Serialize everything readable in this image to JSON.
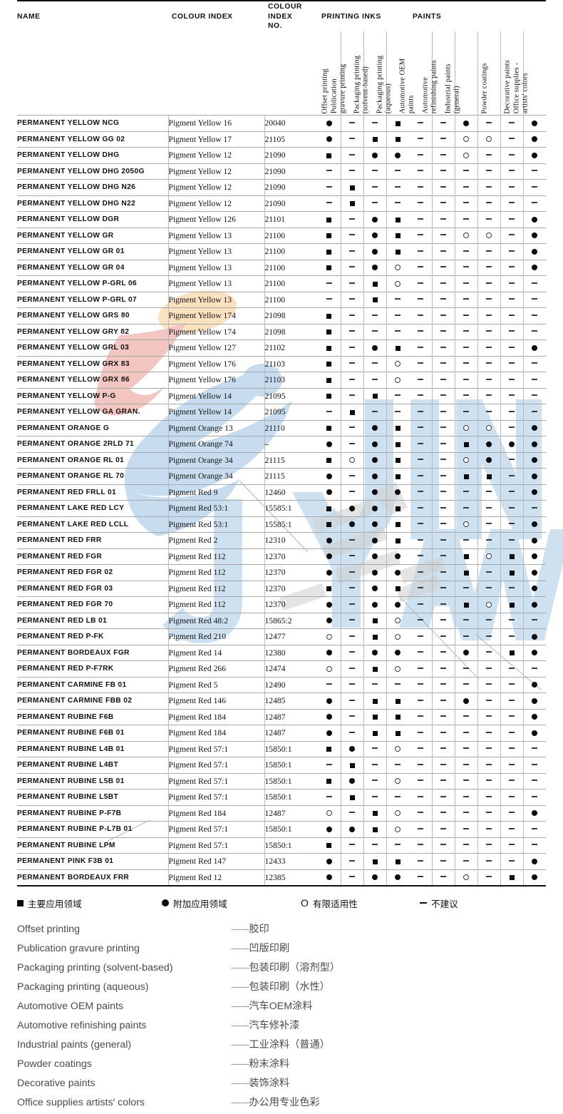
{
  "table": {
    "headers": {
      "name": "NAME",
      "colour_index": "COLOUR INDEX",
      "colour_index_no": "COLOUR\nINDEX\nNO.",
      "colour_index_no_l1": "COLOUR",
      "colour_index_no_l2": "INDEX",
      "colour_index_no_l3": "NO.",
      "group_printing_inks": "PRINTING INKS",
      "group_paints": "PAINTS"
    },
    "columns": [
      {
        "id": "offset",
        "group": "PRINTING INKS",
        "lines": [
          "Offset printing"
        ]
      },
      {
        "id": "pub_gravure",
        "group": "PRINTING INKS",
        "lines": [
          "Publication",
          "gravure printing"
        ]
      },
      {
        "id": "pack_solvent",
        "group": "PRINTING INKS",
        "lines": [
          "Packaging printing",
          "(solvent-based)"
        ]
      },
      {
        "id": "pack_aqueous",
        "group": "PRINTING INKS",
        "lines": [
          "Packaging printing",
          "(aqueous)"
        ]
      },
      {
        "id": "auto_oem",
        "group": "PAINTS",
        "lines": [
          "Automotive OEM",
          "paints"
        ]
      },
      {
        "id": "auto_refinish",
        "group": "PAINTS",
        "lines": [
          "Automotive",
          "refinishing paints"
        ]
      },
      {
        "id": "industrial",
        "group": "PAINTS",
        "lines": [
          "Industrial paints",
          "(general)"
        ]
      },
      {
        "id": "powder",
        "group": "PAINTS",
        "lines": [
          "Powder coatings"
        ]
      },
      {
        "id": "decorative",
        "group": "PAINTS",
        "lines": [
          "Decorative paints"
        ]
      },
      {
        "id": "office",
        "group": "PAINTS",
        "lines": [
          "Office supplies -",
          "artists' colors"
        ]
      }
    ],
    "rows": [
      {
        "name": "PERMANENT YELLOW NCG",
        "ci": "Pigment Yellow 16",
        "cino": "20040",
        "s": [
          "ci",
          "da",
          "da",
          "sq",
          "da",
          "da",
          "ci",
          "da",
          "da",
          "ci"
        ]
      },
      {
        "name": "PERMANENT YELLOW GG 02",
        "ci": "Pigment Yellow 17",
        "cino": "21105",
        "s": [
          "ci",
          "da",
          "sq",
          "sq",
          "da",
          "da",
          "oc",
          "oc",
          "da",
          "ci"
        ]
      },
      {
        "name": "PERMANENT YELLOW DHG",
        "ci": "Pigment Yellow 12",
        "cino": "21090",
        "s": [
          "sq",
          "da",
          "ci",
          "ci",
          "da",
          "da",
          "oc",
          "da",
          "da",
          "ci"
        ]
      },
      {
        "name": "PERMANENT YELLOW DHG 2050G",
        "ci": "Pigment Yellow 12",
        "cino": "21090",
        "s": [
          "da",
          "da",
          "da",
          "da",
          "da",
          "da",
          "da",
          "da",
          "da",
          "da"
        ]
      },
      {
        "name": "PERMANENT YELLOW DHG N26",
        "ci": "Pigment Yellow 12",
        "cino": "21090",
        "s": [
          "da",
          "sq",
          "da",
          "da",
          "da",
          "da",
          "da",
          "da",
          "da",
          "da"
        ]
      },
      {
        "name": "PERMANENT YELLOW DHG N22",
        "ci": "Pigment Yellow 12",
        "cino": "21090",
        "s": [
          "da",
          "sq",
          "da",
          "da",
          "da",
          "da",
          "da",
          "da",
          "da",
          "da"
        ]
      },
      {
        "name": "PERMANENT YELLOW DGR",
        "ci": "Pigment Yellow 126",
        "cino": "21101",
        "s": [
          "sq",
          "da",
          "ci",
          "sq",
          "da",
          "da",
          "da",
          "da",
          "da",
          "ci"
        ]
      },
      {
        "name": "PERMANENT YELLOW GR",
        "ci": "Pigment Yellow 13",
        "cino": "21100",
        "s": [
          "sq",
          "da",
          "ci",
          "sq",
          "da",
          "da",
          "oc",
          "oc",
          "da",
          "ci"
        ]
      },
      {
        "name": "PERMANENT YELLOW GR 01",
        "ci": "Pigment Yellow 13",
        "cino": "21100",
        "s": [
          "sq",
          "da",
          "ci",
          "sq",
          "da",
          "da",
          "da",
          "da",
          "da",
          "ci"
        ]
      },
      {
        "name": "PERMANENT YELLOW GR 04",
        "ci": "Pigment Yellow 13",
        "cino": "21100",
        "s": [
          "sq",
          "da",
          "ci",
          "oc",
          "da",
          "da",
          "da",
          "da",
          "da",
          "ci"
        ]
      },
      {
        "name": "PERMANENT YELLOW P-GRL 06",
        "ci": "Pigment Yellow 13",
        "cino": "21100",
        "s": [
          "da",
          "da",
          "sq",
          "oc",
          "da",
          "da",
          "da",
          "da",
          "da",
          "da"
        ]
      },
      {
        "name": "PERMANENT YELLOW P-GRL 07",
        "ci": "Pigment Yellow 13",
        "cino": "21100",
        "s": [
          "da",
          "da",
          "sq",
          "da",
          "da",
          "da",
          "da",
          "da",
          "da",
          "da"
        ]
      },
      {
        "name": "PERMANENT YELLOW GRS 80",
        "ci": "Pigment Yellow 174",
        "cino": "21098",
        "s": [
          "sq",
          "da",
          "da",
          "da",
          "da",
          "da",
          "da",
          "da",
          "da",
          "da"
        ]
      },
      {
        "name": "PERMANENT YELLOW GRY 82",
        "ci": "Pigment Yellow 174",
        "cino": "21098",
        "s": [
          "sq",
          "da",
          "da",
          "da",
          "da",
          "da",
          "da",
          "da",
          "da",
          "da"
        ]
      },
      {
        "name": "PERMANENT YELLOW GRL 03",
        "ci": "Pigment Yellow 127",
        "cino": "21102",
        "s": [
          "sq",
          "da",
          "ci",
          "sq",
          "da",
          "da",
          "da",
          "da",
          "da",
          "ci"
        ]
      },
      {
        "name": "PERMANENT YELLOW GRX 83",
        "ci": "Pigment Yellow 176",
        "cino": "21103",
        "s": [
          "sq",
          "da",
          "da",
          "oc",
          "da",
          "da",
          "da",
          "da",
          "da",
          "da"
        ]
      },
      {
        "name": "PERMANENT YELLOW GRX 86",
        "ci": "Pigment Yellow 176",
        "cino": "21103",
        "s": [
          "sq",
          "da",
          "da",
          "oc",
          "da",
          "da",
          "da",
          "da",
          "da",
          "da"
        ]
      },
      {
        "name": "PERMANENT YELLOW P-G",
        "ci": "Pigment Yellow 14",
        "cino": "21095",
        "s": [
          "sq",
          "da",
          "sq",
          "da",
          "da",
          "da",
          "da",
          "da",
          "da",
          "da"
        ]
      },
      {
        "name": "PERMANENT YELLOW GA GRAN.",
        "ci": "Pigment Yellow 14",
        "cino": "21095",
        "s": [
          "da",
          "sq",
          "da",
          "da",
          "da",
          "da",
          "da",
          "da",
          "da",
          "da"
        ]
      },
      {
        "name": "PERMANENT ORANGE G",
        "ci": "Pigment Orange 13",
        "cino": "21110",
        "s": [
          "sq",
          "da",
          "ci",
          "sq",
          "da",
          "da",
          "oc",
          "oc",
          "da",
          "ci"
        ]
      },
      {
        "name": "PERMANENT ORANGE 2RLD 71",
        "ci": "Pigment Orange 74",
        "cino": "–",
        "s": [
          "ci",
          "da",
          "ci",
          "sq",
          "da",
          "da",
          "sq",
          "ci",
          "ci",
          "ci"
        ]
      },
      {
        "name": "PERMANENT ORANGE RL 01",
        "ci": "Pigment Orange 34",
        "cino": "21115",
        "s": [
          "sq",
          "oc",
          "ci",
          "sq",
          "da",
          "da",
          "oc",
          "ci",
          "da",
          "ci"
        ]
      },
      {
        "name": "PERMANENT ORANGE RL 70",
        "ci": "Pigment Orange 34",
        "cino": "21115",
        "s": [
          "ci",
          "da",
          "ci",
          "sq",
          "da",
          "da",
          "sq",
          "sq",
          "da",
          "ci"
        ]
      },
      {
        "name": "PERMANENT RED FRLL 01",
        "ci": "Pigment Red 9",
        "cino": "12460",
        "s": [
          "ci",
          "da",
          "ci",
          "ci",
          "da",
          "da",
          "da",
          "da",
          "da",
          "ci"
        ]
      },
      {
        "name": "PERMANENT LAKE RED LCY",
        "ci": "Pigment Red 53:1",
        "cino": "15585:1",
        "s": [
          "sq",
          "ci",
          "ci",
          "sq",
          "da",
          "da",
          "da",
          "da",
          "da",
          "da"
        ]
      },
      {
        "name": "PERMANENT LAKE RED LCLL",
        "ci": "Pigment Red 53:1",
        "cino": "15585:1",
        "s": [
          "sq",
          "ci",
          "ci",
          "sq",
          "da",
          "da",
          "oc",
          "da",
          "da",
          "ci"
        ]
      },
      {
        "name": "PERMANENT RED FRR",
        "ci": "Pigment Red 2",
        "cino": "12310",
        "s": [
          "ci",
          "da",
          "ci",
          "sq",
          "da",
          "da",
          "da",
          "da",
          "da",
          "ci"
        ]
      },
      {
        "name": "PERMANENT RED FGR",
        "ci": "Pigment Red 112",
        "cino": "12370",
        "s": [
          "ci",
          "da",
          "ci",
          "ci",
          "da",
          "da",
          "sq",
          "oc",
          "sq",
          "ci"
        ]
      },
      {
        "name": "PERMANENT RED FGR 02",
        "ci": "Pigment Red 112",
        "cino": "12370",
        "s": [
          "ci",
          "da",
          "ci",
          "ci",
          "da",
          "da",
          "sq",
          "da",
          "sq",
          "ci"
        ]
      },
      {
        "name": "PERMANENT RED FGR 03",
        "ci": "Pigment Red 112",
        "cino": "12370",
        "s": [
          "sq",
          "da",
          "ci",
          "sq",
          "da",
          "da",
          "da",
          "da",
          "da",
          "ci"
        ]
      },
      {
        "name": "PERMANENT RED FGR 70",
        "ci": "Pigment Red 112",
        "cino": "12370",
        "s": [
          "ci",
          "da",
          "ci",
          "ci",
          "da",
          "da",
          "sq",
          "oc",
          "sq",
          "ci"
        ]
      },
      {
        "name": "PERMANENT RED LB 01",
        "ci": "Pigment Red 48:2",
        "cino": "15865:2",
        "s": [
          "ci",
          "da",
          "sq",
          "oc",
          "da",
          "da",
          "da",
          "da",
          "da",
          "da"
        ]
      },
      {
        "name": "PERMANENT RED P-FK",
        "ci": "Pigment Red 210",
        "cino": "12477",
        "s": [
          "oc",
          "da",
          "sq",
          "oc",
          "da",
          "da",
          "da",
          "da",
          "da",
          "ci"
        ]
      },
      {
        "name": "PERMANENT BORDEAUX FGR",
        "ci": "Pigment Red 14",
        "cino": "12380",
        "s": [
          "ci",
          "da",
          "ci",
          "ci",
          "da",
          "da",
          "ci",
          "da",
          "sq",
          "ci"
        ]
      },
      {
        "name": "PERMANENT RED P-F7RK",
        "ci": "Pigment Red 266",
        "cino": "12474",
        "s": [
          "oc",
          "da",
          "sq",
          "oc",
          "da",
          "da",
          "da",
          "da",
          "da",
          "da"
        ]
      },
      {
        "name": "PERMANENT CARMINE FB 01",
        "ci": "Pigment Red 5",
        "cino": "12490",
        "s": [
          "da",
          "da",
          "da",
          "da",
          "da",
          "da",
          "da",
          "da",
          "da",
          "ci"
        ]
      },
      {
        "name": "PERMANENT CARMINE FBB 02",
        "ci": "Pigment Red 146",
        "cino": "12485",
        "s": [
          "ci",
          "da",
          "sq",
          "sq",
          "da",
          "da",
          "ci",
          "da",
          "da",
          "ci"
        ]
      },
      {
        "name": "PERMANENT RUBINE F6B",
        "ci": "Pigment Red 184",
        "cino": "12487",
        "s": [
          "ci",
          "da",
          "sq",
          "sq",
          "da",
          "da",
          "da",
          "da",
          "da",
          "ci"
        ]
      },
      {
        "name": "PERMANENT RUBINE F6B 01",
        "ci": "Pigment Red 184",
        "cino": "12487",
        "s": [
          "ci",
          "da",
          "sq",
          "sq",
          "da",
          "da",
          "da",
          "da",
          "da",
          "ci"
        ]
      },
      {
        "name": "PERMANENT RUBINE L4B 01",
        "ci": "Pigment Red 57:1",
        "cino": "15850:1",
        "s": [
          "sq",
          "ci",
          "da",
          "oc",
          "da",
          "da",
          "da",
          "da",
          "da",
          "da"
        ]
      },
      {
        "name": "PERMANENT RUBINE L4BT",
        "ci": "Pigment Red 57:1",
        "cino": "15850:1",
        "s": [
          "da",
          "sq",
          "da",
          "da",
          "da",
          "da",
          "da",
          "da",
          "da",
          "da"
        ]
      },
      {
        "name": "PERMANENT RUBINE L5B 01",
        "ci": "Pigment Red 57:1",
        "cino": "15850:1",
        "s": [
          "sq",
          "ci",
          "da",
          "oc",
          "da",
          "da",
          "da",
          "da",
          "da",
          "da"
        ]
      },
      {
        "name": "PERMANENT RUBINE L5BT",
        "ci": "Pigment Red 57:1",
        "cino": "15850:1",
        "s": [
          "da",
          "sq",
          "da",
          "da",
          "da",
          "da",
          "da",
          "da",
          "da",
          "da"
        ]
      },
      {
        "name": "PERMANENT RUBINE P-F7B",
        "ci": "Pigment Red 184",
        "cino": "12487",
        "s": [
          "oc",
          "da",
          "sq",
          "oc",
          "da",
          "da",
          "da",
          "da",
          "da",
          "ci"
        ]
      },
      {
        "name": "PERMANENT RUBINE P-L7B 01",
        "ci": "Pigment Red 57:1",
        "cino": "15850:1",
        "s": [
          "ci",
          "ci",
          "sq",
          "oc",
          "da",
          "da",
          "da",
          "da",
          "da",
          "da"
        ]
      },
      {
        "name": "PERMANENT RUBINE LPM",
        "ci": "Pigment Red 57:1",
        "cino": "15850:1",
        "s": [
          "sq",
          "da",
          "da",
          "da",
          "da",
          "da",
          "da",
          "da",
          "da",
          "da"
        ]
      },
      {
        "name": "PERMANENT PINK F3B 01",
        "ci": "Pigment Red 147",
        "cino": "12433",
        "s": [
          "ci",
          "da",
          "sq",
          "sq",
          "da",
          "da",
          "da",
          "da",
          "da",
          "ci"
        ]
      },
      {
        "name": "PERMANENT BORDEAUX FRR",
        "ci": "Pigment Red 12",
        "cino": "12385",
        "s": [
          "ci",
          "da",
          "ci",
          "ci",
          "da",
          "da",
          "oc",
          "da",
          "sq",
          "ci"
        ]
      }
    ]
  },
  "legend_key": [
    {
      "glyph": "sq",
      "label": "主要应用领域"
    },
    {
      "glyph": "ci",
      "label": "附加应用领域"
    },
    {
      "glyph": "oc",
      "label": "有限适用性"
    },
    {
      "glyph": "da",
      "label": "不建议"
    }
  ],
  "glossary": [
    {
      "en": "Offset printing",
      "dots": "------",
      "zh": "胶印"
    },
    {
      "en": "Publication  gravure printing",
      "dots": "------",
      "zh": "凹版印刷"
    },
    {
      "en": "Packaging printing (solvent-based)",
      "dots": "------",
      "zh": "包装印刷（溶剂型）"
    },
    {
      "en": "Packaging printing (aqueous)",
      "dots": "------",
      "zh": "包装印刷（水性）"
    },
    {
      "en": "Automotive OEM paints",
      "dots": "------",
      "zh": "汽车OEM涂料"
    },
    {
      "en": "Automotive  refinishing paints",
      "dots": "------",
      "zh": "汽车修补漆"
    },
    {
      "en": "Industrial paints (general)",
      "dots": "------",
      "zh": "工业涂料（普通）"
    },
    {
      "en": "Powder coatings",
      "dots": "------",
      "zh": "粉末涂料"
    },
    {
      "en": "Decorative paints",
      "dots": "------",
      "zh": "装饰涂料"
    },
    {
      "en": "Office supplies artists′   colors",
      "dots": "------",
      "zh": "办公用专业色彩"
    }
  ],
  "colors": {
    "rule": "#111111",
    "hairline": "#a8a8a8",
    "watermark_blue": "#c5dcef",
    "watermark_pink": "#f3c3bf",
    "watermark_peach": "#fae0bc",
    "watermark_gray": "#d8d8d8"
  }
}
